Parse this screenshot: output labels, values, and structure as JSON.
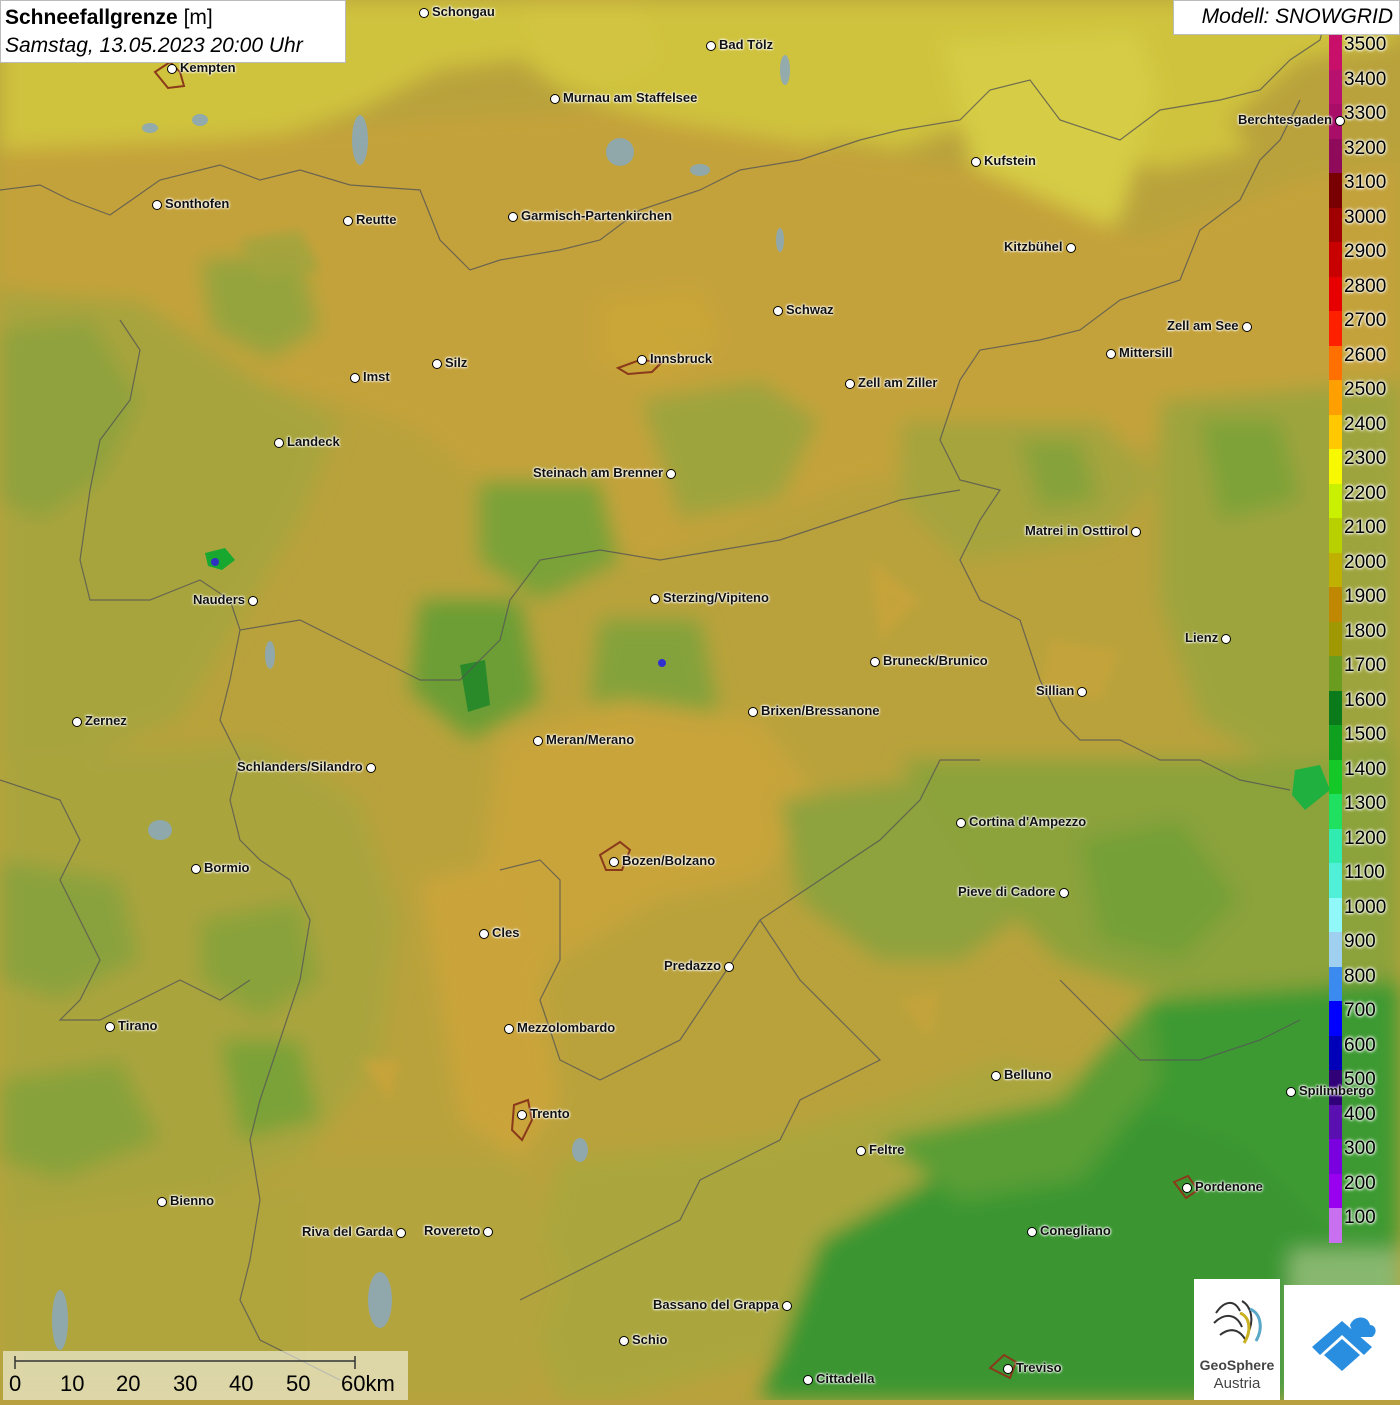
{
  "title": {
    "name": "Schneefallgrenze",
    "unit": "[m]",
    "datetime": "Samstag, 13.05.2023 20:00 Uhr"
  },
  "model": "Modell: SNOWGRID",
  "legend": {
    "values": [
      "3500",
      "3400",
      "3300",
      "3200",
      "3100",
      "3000",
      "2900",
      "2800",
      "2700",
      "2600",
      "2500",
      "2400",
      "2300",
      "2200",
      "2100",
      "2000",
      "1900",
      "1800",
      "1700",
      "1600",
      "1500",
      "1400",
      "1300",
      "1200",
      "1100",
      "1000",
      "900",
      "800",
      "700",
      "600",
      "500",
      "400",
      "300",
      "200",
      "100"
    ],
    "colors": [
      "#c8106a",
      "#b8106e",
      "#a80e68",
      "#900a5c",
      "#780000",
      "#a00000",
      "#c80000",
      "#e80000",
      "#ff2000",
      "#ff7000",
      "#ffa000",
      "#ffc800",
      "#f8f800",
      "#c8f000",
      "#b8d000",
      "#c0b000",
      "#c08800",
      "#a09800",
      "#6a9c20",
      "#0a7a1a",
      "#10a020",
      "#14c828",
      "#20e060",
      "#30ecb0",
      "#50f0d8",
      "#90f8f8",
      "#a0d0f0",
      "#3a8af0",
      "#0000ff",
      "#0000b8",
      "#300078",
      "#5a10b0",
      "#7a00e0",
      "#9a00f0",
      "#c870f0"
    ]
  },
  "cities": [
    {
      "name": "Schongau"
    },
    {
      "name": "Bad Tölz"
    },
    {
      "name": "Kempten"
    },
    {
      "name": "Murnau am Staffelsee"
    },
    {
      "name": "Berchtesgaden"
    },
    {
      "name": "Kufstein"
    },
    {
      "name": "Sonthofen"
    },
    {
      "name": "Reutte"
    },
    {
      "name": "Garmisch-Partenkirchen"
    },
    {
      "name": "Kitzbühel"
    },
    {
      "name": "Schwaz"
    },
    {
      "name": "Zell am See"
    },
    {
      "name": "Innsbruck"
    },
    {
      "name": "Mittersill"
    },
    {
      "name": "Imst"
    },
    {
      "name": "Silz"
    },
    {
      "name": "Zell am Ziller"
    },
    {
      "name": "Landeck"
    },
    {
      "name": "Steinach am Brenner"
    },
    {
      "name": "Matrei in Osttirol"
    },
    {
      "name": "Nauders"
    },
    {
      "name": "Sterzing/Vipiteno"
    },
    {
      "name": "Lienz"
    },
    {
      "name": "Bruneck/Brunico"
    },
    {
      "name": "Sillian"
    },
    {
      "name": "Brixen/Bressanone"
    },
    {
      "name": "Zernez"
    },
    {
      "name": "Meran/Merano"
    },
    {
      "name": "Schlanders/Silandro"
    },
    {
      "name": "Cortina d'Ampezzo"
    },
    {
      "name": "Bozen/Bolzano"
    },
    {
      "name": "Bormio"
    },
    {
      "name": "Pieve di Cadore"
    },
    {
      "name": "Cles"
    },
    {
      "name": "Predazzo"
    },
    {
      "name": "Tirano"
    },
    {
      "name": "Mezzolombardo"
    },
    {
      "name": "Belluno"
    },
    {
      "name": "Spilimbergo"
    },
    {
      "name": "Trento"
    },
    {
      "name": "Feltre"
    },
    {
      "name": "Pordenone"
    },
    {
      "name": "Bienno"
    },
    {
      "name": "Riva del Garda"
    },
    {
      "name": "Rovereto"
    },
    {
      "name": "Conegliano"
    },
    {
      "name": "Bassano del Grappa"
    },
    {
      "name": "Schio"
    },
    {
      "name": "Treviso"
    },
    {
      "name": "Cittadella"
    }
  ],
  "scale": {
    "labels": [
      "0",
      "10",
      "20",
      "30",
      "40",
      "50",
      "60km"
    ]
  },
  "logos": {
    "geosphere_line1": "GeoSphere",
    "geosphere_line2": "Austria"
  }
}
